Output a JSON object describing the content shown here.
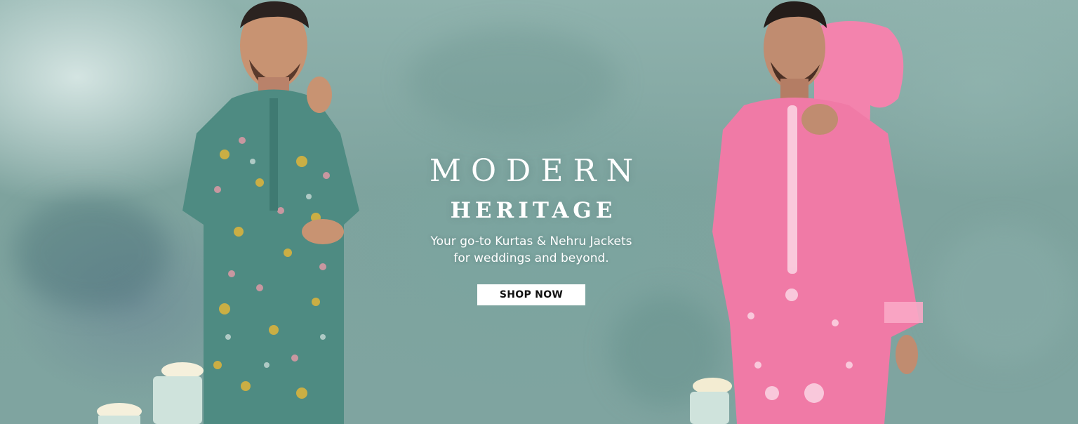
{
  "banner": {
    "headline_line1": "MODERN",
    "headline_line2": "HERITAGE",
    "subtitle_line1": "Your go-to Kurtas & Nehru Jackets",
    "subtitle_line2": "for weddings and beyond.",
    "cta_label": "SHOP NOW"
  },
  "colors": {
    "background": "#8fb2ad",
    "left_kurta": "#4e8b82",
    "right_kurta": "#f07aa6",
    "cta_background": "#ffffff",
    "cta_text": "#111111",
    "headline_text": "#ffffff"
  }
}
